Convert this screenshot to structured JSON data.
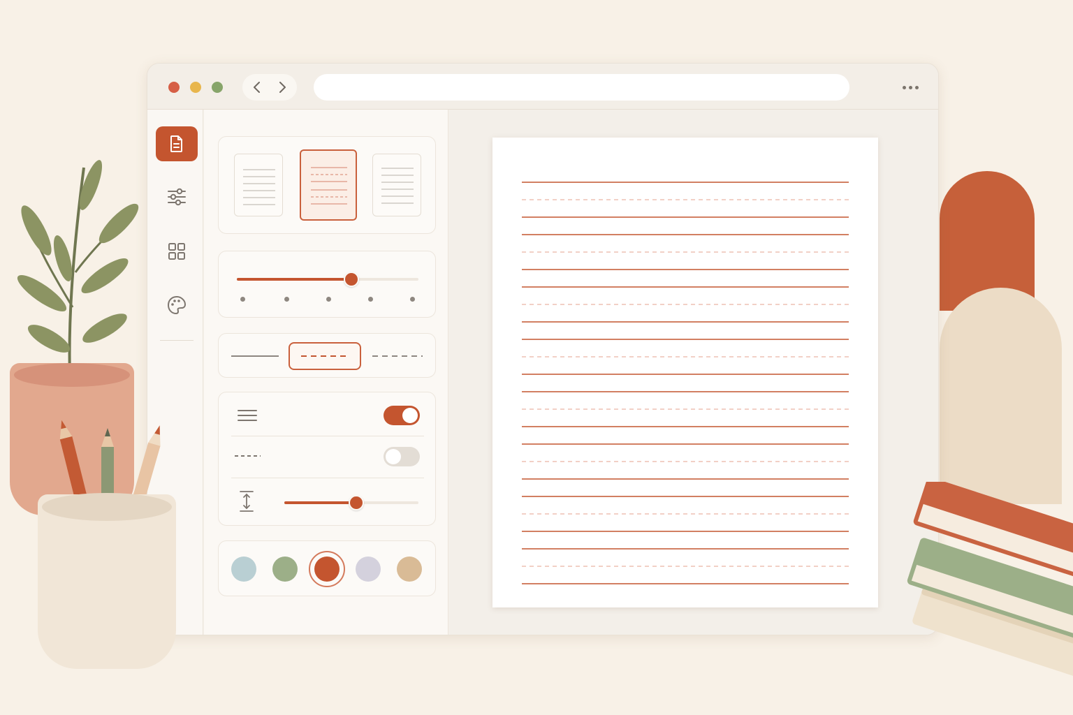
{
  "window": {
    "traffic_lights": [
      "close",
      "minimize",
      "maximize"
    ],
    "address_bar": {
      "value": "",
      "placeholder": ""
    }
  },
  "sidebar": {
    "items": [
      {
        "icon": "document-icon",
        "active": true
      },
      {
        "icon": "sliders-icon",
        "active": false
      },
      {
        "icon": "grid-icon",
        "active": false
      },
      {
        "icon": "palette-icon",
        "active": false
      }
    ]
  },
  "panel": {
    "templates": [
      {
        "style": "solid-lines",
        "selected": false
      },
      {
        "style": "handwriting-dashed-midline",
        "selected": true
      },
      {
        "style": "solid-lines-wide",
        "selected": false
      }
    ],
    "line_spacing_slider": {
      "value": 0.6,
      "ticks": 5
    },
    "line_styles": [
      {
        "style": "solid",
        "selected": false
      },
      {
        "style": "dashed",
        "selected": true
      },
      {
        "style": "dotted",
        "selected": false
      }
    ],
    "settings": {
      "show_lines_toggle": true,
      "dashed_midline_toggle": false,
      "height_slider": {
        "value": 0.52
      }
    },
    "colors": [
      {
        "hex": "#b9cfd3",
        "selected": false
      },
      {
        "hex": "#9caf88",
        "selected": false
      },
      {
        "hex": "#c4552f",
        "selected": true
      },
      {
        "hex": "#d4d1dd",
        "selected": false
      },
      {
        "hex": "#d9bb96",
        "selected": false
      }
    ]
  },
  "preview": {
    "line_color": "#c4552f",
    "dashed_color": "#e6a08c",
    "pattern": [
      "solid",
      "dashed",
      "solid"
    ]
  },
  "colors": {
    "accent": "#c4552f",
    "background": "#f8f1e7"
  }
}
